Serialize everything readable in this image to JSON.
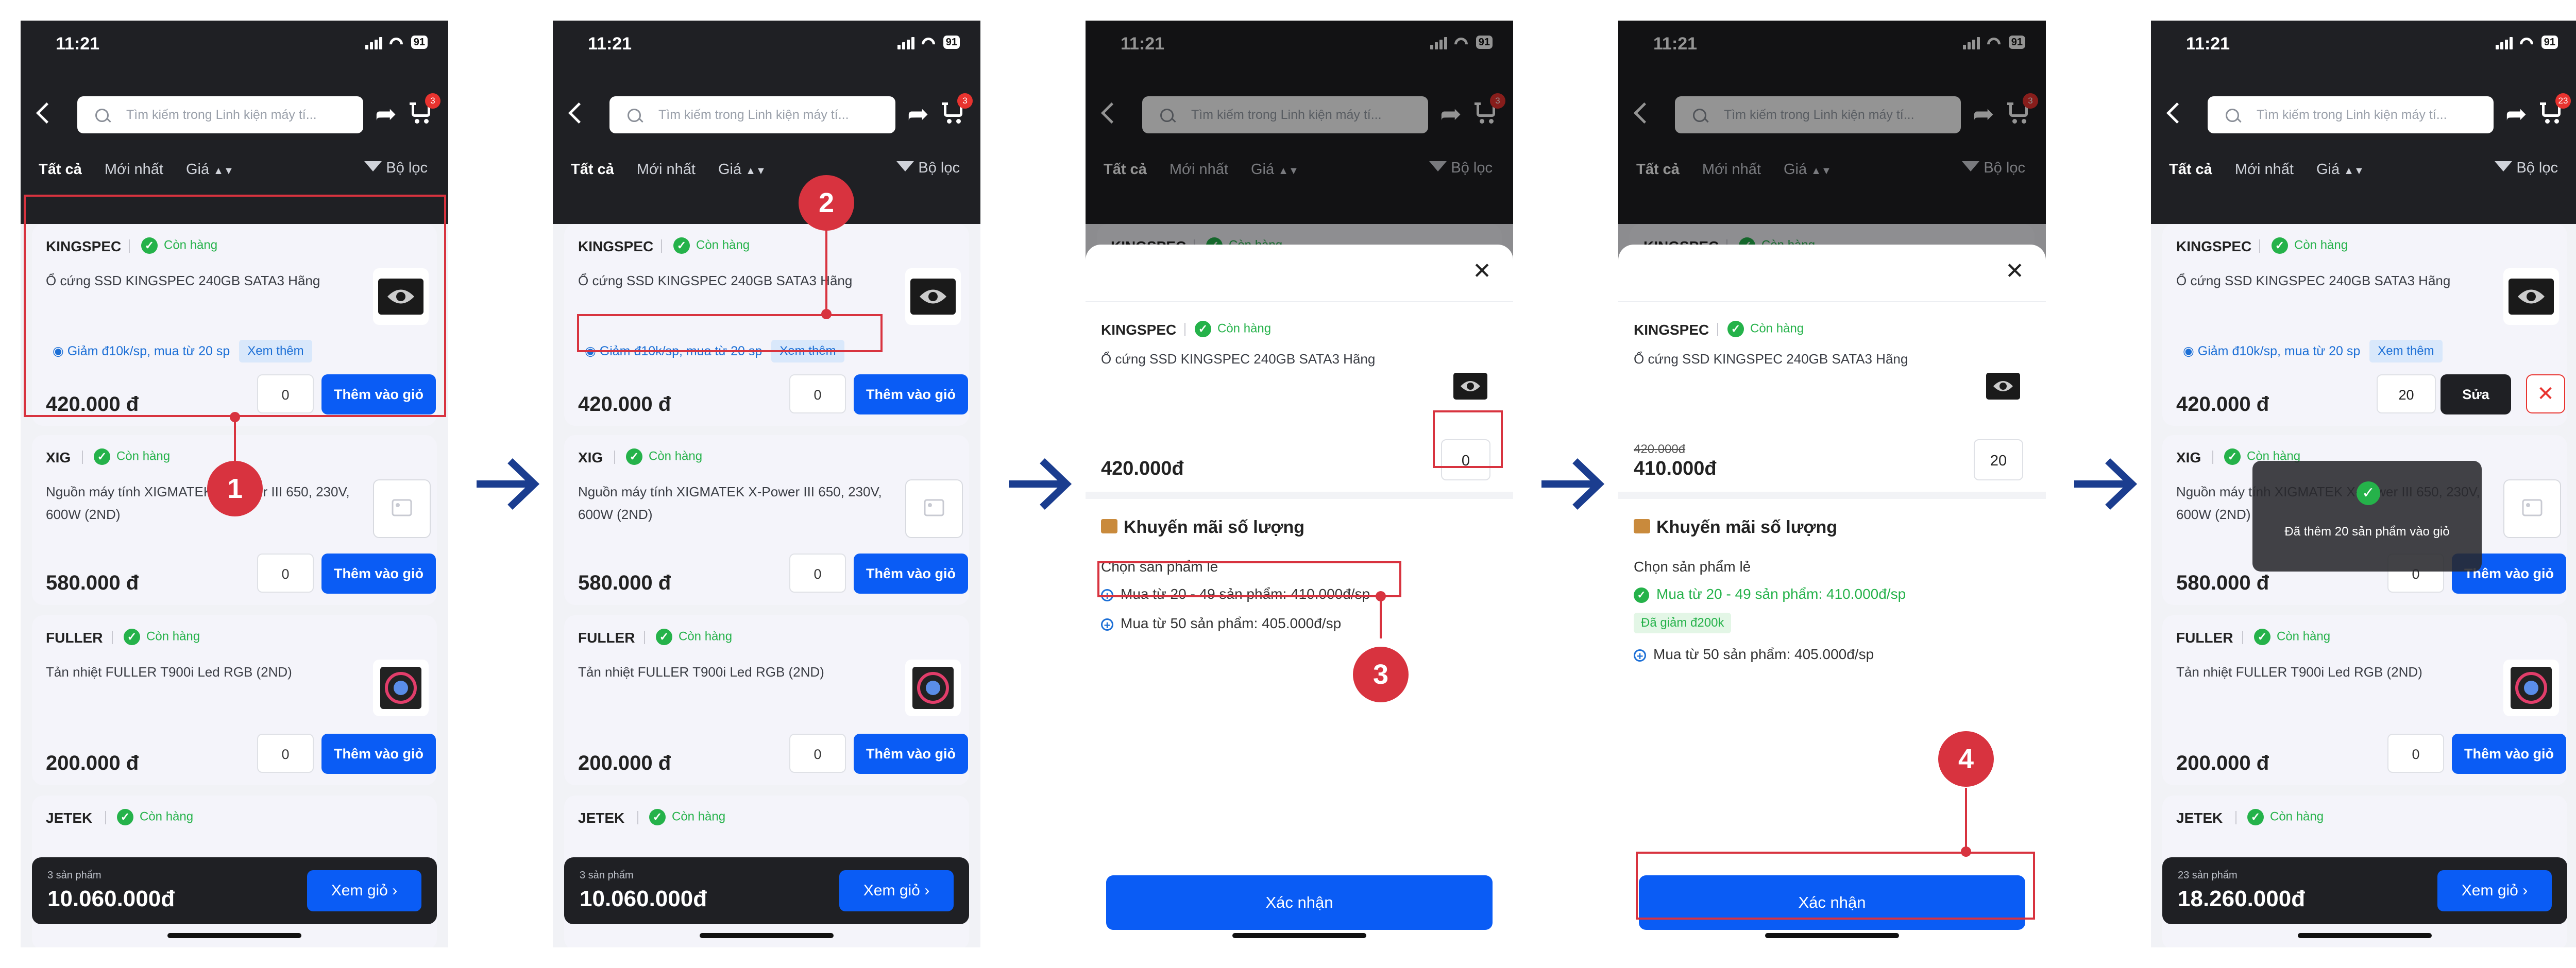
{
  "status": {
    "time": "11:21",
    "battery": "91"
  },
  "header": {
    "search_placeholder": "Tìm kiếm trong Linh kiện máy tí...",
    "cart_badge": "3",
    "cart_badge_after": "23"
  },
  "filters": {
    "all": "Tất cả",
    "newest": "Mới nhất",
    "price": "Giá",
    "filter": "Bộ lọc"
  },
  "common": {
    "in_stock": "Còn hàng",
    "add_to_cart": "Thêm vào giỏ",
    "view_cart": "Xem giỏ"
  },
  "products": [
    {
      "brand": "KINGSPEC",
      "name": "Ổ cứng SSD KINGSPEC 240GB SATA3 Hãng",
      "price": "420.000 đ",
      "qty": "0",
      "promo": "Giảm đ10k/sp, mua từ 20 sp",
      "promo_more": "Xem thêm"
    },
    {
      "brand": "XIG",
      "name": "Nguồn máy tính XIGMATEK X-Power III 650, 230V, 600W (2ND)",
      "price": "580.000 đ",
      "qty": "0"
    },
    {
      "brand": "FULLER",
      "name": "Tản nhiệt FULLER T900i Led RGB (2ND)",
      "price": "200.000 đ",
      "qty": "0"
    },
    {
      "brand": "JETEK"
    }
  ],
  "summary": {
    "count_before": "3 sản phẩm",
    "total_before": "10.060.000đ",
    "count_after": "23 sản phẩm",
    "total_after": "18.260.000đ"
  },
  "sheet": {
    "price": "420.000đ",
    "qty_before": "0",
    "qty_after": "20",
    "old_price": "420.000đ",
    "new_price": "410.000đ",
    "promo_title": "Khuyến mãi số lượng",
    "promo_label": "Chọn sản phẩm lẻ",
    "opt1": "Mua từ 20 - 49 sản phẩm: 410.000đ/sp",
    "opt2": "Mua từ 50 sản phẩm: 405.000đ/sp",
    "saved": "Đã giảm đ200k",
    "confirm": "Xác nhận"
  },
  "final": {
    "qty": "20",
    "edit": "Sửa",
    "toast": "Đã thêm 20 sản phẩm vào giỏ"
  },
  "steps": [
    "1",
    "2",
    "3",
    "4"
  ],
  "colors": {
    "accent": "#0a5cf5",
    "dark": "#1f2024",
    "highlight": "#d8333f",
    "stock": "#25b24a",
    "arrow": "#1b3d8f"
  },
  "icons": [
    "back-icon",
    "search-icon",
    "share-icon",
    "cart-icon",
    "filter-icon",
    "sort-icon",
    "check-icon",
    "close-icon",
    "plus-circle-icon",
    "delete-icon",
    "promo-icon",
    "chevron-right-icon",
    "arrow-right-icon",
    "image-placeholder-icon"
  ]
}
